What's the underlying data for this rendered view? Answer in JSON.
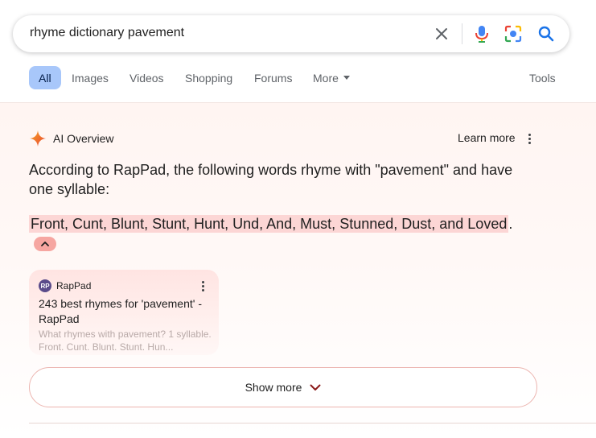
{
  "search": {
    "query": "rhyme dictionary pavement"
  },
  "tabs": [
    {
      "label": "All"
    },
    {
      "label": "Images"
    },
    {
      "label": "Videos"
    },
    {
      "label": "Shopping"
    },
    {
      "label": "Forums"
    },
    {
      "label": "More"
    }
  ],
  "tools_label": "Tools",
  "ai_overview": {
    "title": "AI Overview",
    "learn_more": "Learn more",
    "intro": "According to RapPad, the following words rhyme with \"pavement\" and have one syllable:",
    "answer": "Front, Cunt, Blunt, Stunt, Hunt, Und, And, Must, Stunned, Dust, and Loved",
    "answer_end": ".",
    "source": {
      "logo_text": "RP",
      "name": "RapPad",
      "title": "243 best rhymes for 'pavement' - RapPad",
      "snippet": "What rhymes with pavement? 1 syllable. Front. Cunt. Blunt. Stunt. Hun..."
    },
    "show_more": "Show more"
  },
  "colors": {
    "accent_blue": "#0b57d0",
    "tab_active_bg": "#a8c7fa",
    "highlight": "#fcd6d5",
    "mic_blue": "#4285f4",
    "mic_red": "#ea4335",
    "search_blue": "#1a73e8"
  }
}
